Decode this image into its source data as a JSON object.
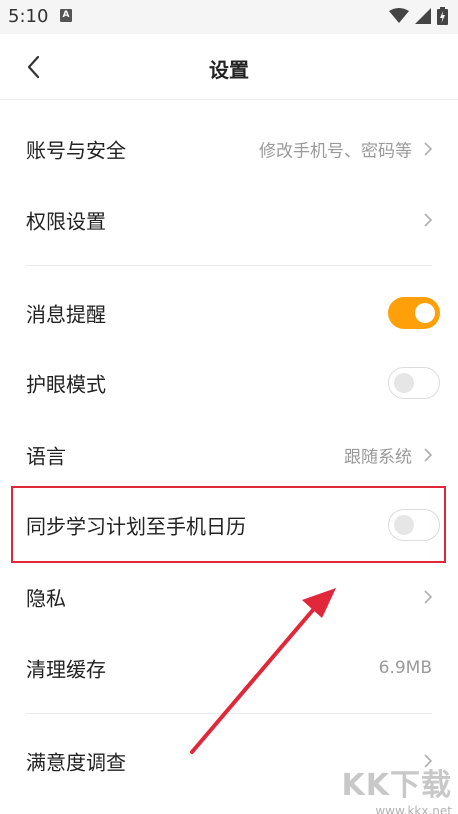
{
  "status_bar": {
    "time": "5:10",
    "notification_letter": "A",
    "icons": [
      "wifi-icon",
      "cellular-icon",
      "battery-charging-icon"
    ]
  },
  "header": {
    "back_icon": "chevron-left-icon",
    "title": "设置"
  },
  "settings": {
    "account": {
      "label": "账号与安全",
      "value": "修改手机号、密码等"
    },
    "permissions": {
      "label": "权限设置"
    },
    "notifications": {
      "label": "消息提醒",
      "toggle_on": true
    },
    "eye_care": {
      "label": "护眼模式",
      "toggle_on": false
    },
    "language": {
      "label": "语言",
      "value": "跟随系统"
    },
    "calendar_sync": {
      "label": "同步学习计划至手机日历",
      "toggle_on": false
    },
    "privacy": {
      "label": "隐私"
    },
    "clear_cache": {
      "label": "清理缓存",
      "value": "6.9MB"
    },
    "survey": {
      "label": "满意度调查"
    }
  },
  "colors": {
    "accent": "#ff9f0a",
    "annotation_red": "#e0283a",
    "secondary_text": "#9a9a9a"
  },
  "watermark": {
    "logo": "KK下载",
    "url": "www.kkx.net"
  }
}
